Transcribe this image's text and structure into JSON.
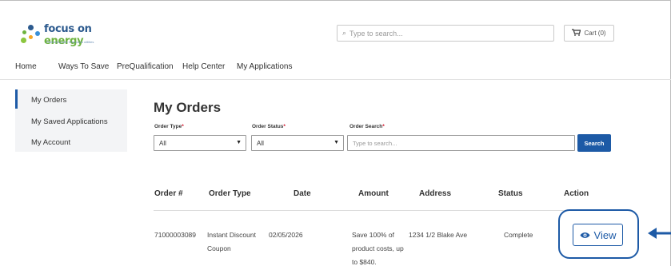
{
  "header": {
    "logo_text_1": "focus on",
    "logo_text_2": " energy",
    "logo_tagline": "Partnering with Wisconsin utilities",
    "search_placeholder": "Type to search...",
    "cart_label": "Cart (0)"
  },
  "nav": {
    "items": [
      "Home",
      "Ways To Save",
      "PreQualification",
      "Help Center",
      "My Applications"
    ]
  },
  "sidebar": {
    "items": [
      {
        "label": "My Orders",
        "active": true
      },
      {
        "label": "My Saved Applications",
        "active": false
      },
      {
        "label": "My Account",
        "active": false
      }
    ]
  },
  "main": {
    "title": "My Orders",
    "filters": {
      "order_type_label": "Order Type",
      "order_type_value": "All",
      "order_status_label": "Order Status",
      "order_status_value": "All",
      "order_search_label": "Order Search",
      "order_search_placeholder": "Type to search...",
      "required_mark": "*",
      "search_button": "Search"
    },
    "table": {
      "columns": [
        "Order #",
        "Order Type",
        "Date",
        "Amount",
        "Address",
        "Status",
        "Action"
      ],
      "rows": [
        {
          "order_number": "71000003089",
          "order_type": "Instant Discount Coupon",
          "date": "02/05/2026",
          "amount": "Save 100% of product costs, up to $840.",
          "address": "1234 1/2 Blake Ave",
          "status": "Complete",
          "action": "View"
        }
      ]
    }
  },
  "colors": {
    "brand_blue": "#1d5aa6",
    "logo_green": "#6db33f",
    "required_red": "#d0021b"
  }
}
